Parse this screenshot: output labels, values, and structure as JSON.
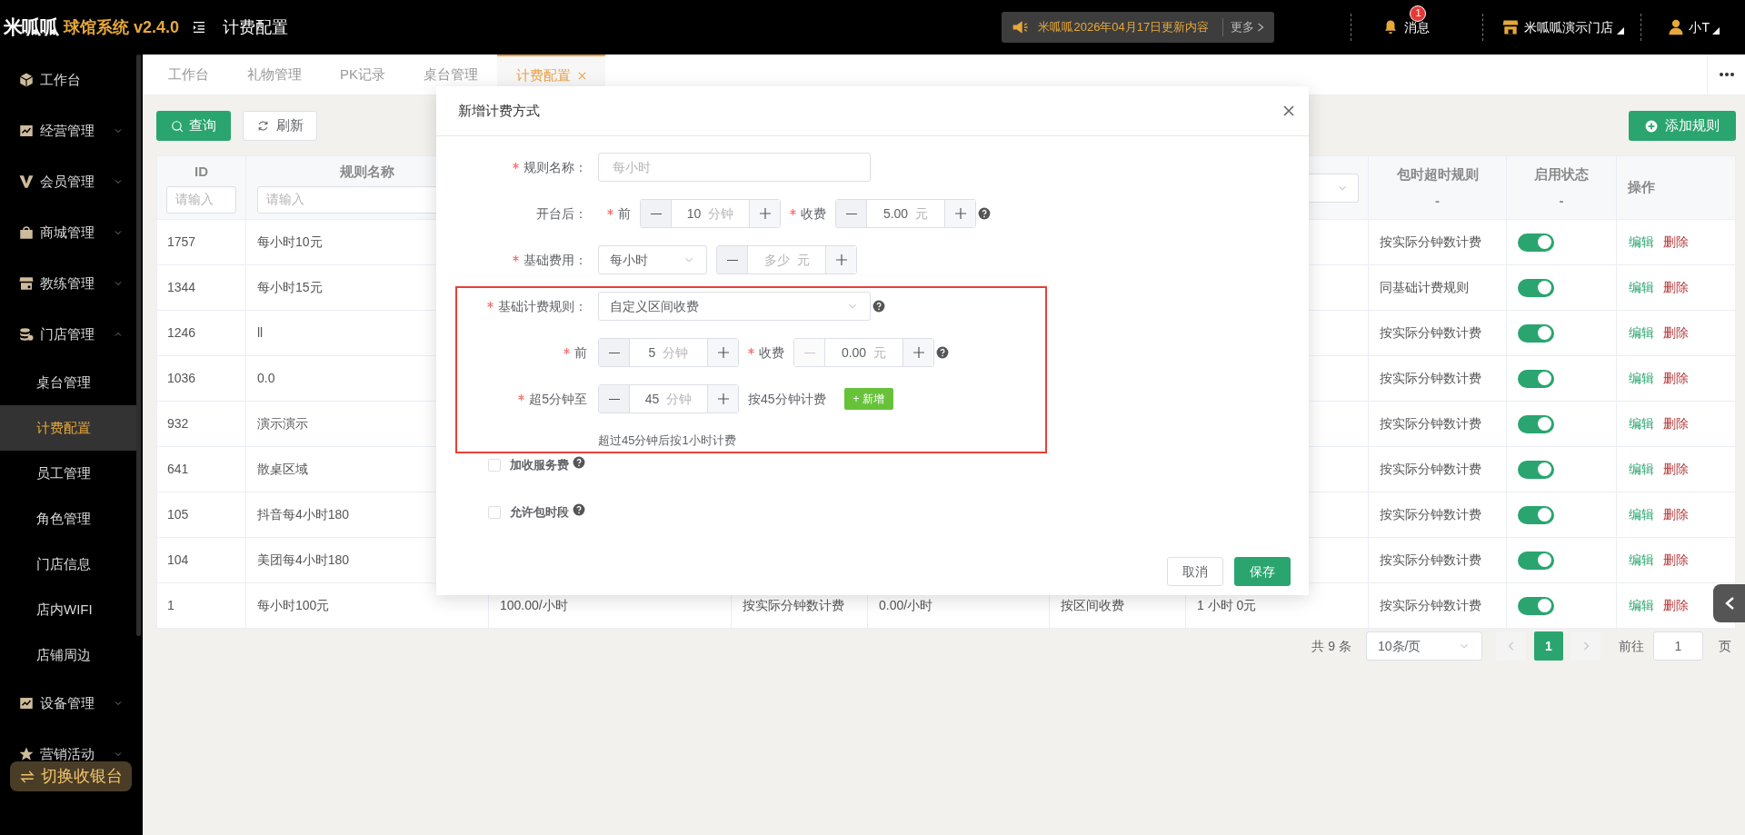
{
  "header": {
    "logo": "米呱呱",
    "app_title": "球馆系统 v2.4.0",
    "page_title": "计费配置",
    "notice": {
      "text": "米呱呱2026年04月17日更新内容",
      "more": "更多"
    },
    "messages": {
      "label": "消息",
      "badge": "1"
    },
    "store": "米呱呱演示门店",
    "user": "小T"
  },
  "sidebar": {
    "items": [
      {
        "label": "工作台"
      },
      {
        "label": "经营管理",
        "expanded": false
      },
      {
        "label": "会员管理",
        "expanded": false
      },
      {
        "label": "商城管理",
        "expanded": false
      },
      {
        "label": "教练管理",
        "expanded": false
      },
      {
        "label": "门店管理",
        "expanded": true,
        "children": [
          {
            "label": "桌台管理",
            "selected": false
          },
          {
            "label": "计费配置",
            "selected": true
          },
          {
            "label": "员工管理",
            "selected": false
          },
          {
            "label": "角色管理",
            "selected": false
          },
          {
            "label": "门店信息",
            "selected": false
          },
          {
            "label": "店内WIFI",
            "selected": false
          },
          {
            "label": "店铺周边",
            "selected": false
          }
        ]
      },
      {
        "label": "设备管理",
        "expanded": false
      },
      {
        "label": "营销活动",
        "expanded": false
      }
    ],
    "switch_button": "切换收银台"
  },
  "tabs": [
    {
      "label": "工作台",
      "selected": false
    },
    {
      "label": "礼物管理",
      "selected": false
    },
    {
      "label": "PK记录",
      "selected": false
    },
    {
      "label": "桌台管理",
      "selected": false
    },
    {
      "label": "计费配置",
      "selected": true
    }
  ],
  "toolbar": {
    "query": "查询",
    "refresh": "刷新",
    "add": "添加规则"
  },
  "table": {
    "id_column": {
      "title": "ID",
      "placeholder": "请输入"
    },
    "name_column": {
      "title": "规则名称",
      "placeholder": "请输入"
    },
    "column_7": {
      "filter": {
        "kind": "select"
      }
    },
    "overtime_column": {
      "title": "包时超时规则",
      "subtitle": "-"
    },
    "status_column": {
      "title": "启用状态",
      "subtitle": "-"
    },
    "actions_column": {
      "title": "操作"
    },
    "rows": [
      {
        "id": "1757",
        "name": "每小时10元",
        "overtime_rule": "按实际分钟数计费",
        "enabled": true,
        "actions": [
          {
            "label": "编辑",
            "kind": "edit"
          },
          {
            "label": "删除",
            "kind": "delete"
          }
        ]
      },
      {
        "id": "1344",
        "name": "每小时15元",
        "overtime_rule": "同基础计费规则",
        "enabled": true,
        "actions": [
          {
            "label": "编辑",
            "kind": "edit"
          },
          {
            "label": "删除",
            "kind": "delete"
          }
        ]
      },
      {
        "id": "1246",
        "name": "ll",
        "overtime_rule": "按实际分钟数计费",
        "enabled": true,
        "actions": [
          {
            "label": "编辑",
            "kind": "edit"
          },
          {
            "label": "删除",
            "kind": "delete"
          }
        ]
      },
      {
        "id": "1036",
        "name": "0.0",
        "overtime_rule": "按实际分钟数计费",
        "enabled": true,
        "actions": [
          {
            "label": "编辑",
            "kind": "edit"
          },
          {
            "label": "删除",
            "kind": "delete"
          }
        ]
      },
      {
        "id": "932",
        "name": "演示演示",
        "overtime_rule": "按实际分钟数计费",
        "enabled": true,
        "actions": [
          {
            "label": "编辑",
            "kind": "edit"
          },
          {
            "label": "删除",
            "kind": "delete"
          }
        ]
      },
      {
        "id": "641",
        "name": "散桌区域",
        "overtime_rule": "按实际分钟数计费",
        "enabled": true,
        "actions": [
          {
            "label": "编辑",
            "kind": "edit"
          },
          {
            "label": "删除",
            "kind": "delete"
          }
        ]
      },
      {
        "id": "105",
        "name": "抖音每4小时180",
        "overtime_rule": "按实际分钟数计费",
        "enabled": true,
        "actions": [
          {
            "label": "编辑",
            "kind": "edit"
          },
          {
            "label": "删除",
            "kind": "delete"
          }
        ]
      },
      {
        "id": "104",
        "name": "美团每4小时180",
        "overtime_rule": "按实际分钟数计费",
        "enabled": true,
        "actions": [
          {
            "label": "编辑",
            "kind": "edit"
          },
          {
            "label": "删除",
            "kind": "delete"
          }
        ]
      },
      {
        "id": "1",
        "name": "每小时100元",
        "column_3": "100.00/小时",
        "column_4": "按实际分钟数计费",
        "column_5": "0.00/小时",
        "column_6": "按区间收费",
        "column_7": "1 小时 0元",
        "overtime_rule": "按实际分钟数计费",
        "enabled": true,
        "actions": [
          {
            "label": "编辑",
            "kind": "edit"
          },
          {
            "label": "删除",
            "kind": "delete"
          }
        ]
      }
    ]
  },
  "pagination": {
    "total": "共 9 条",
    "page_size": "10条/页",
    "pages": [
      {
        "label": "1",
        "selected": true
      }
    ],
    "goto_label": "前往",
    "goto_value": "1",
    "goto_suffix": "页"
  },
  "dialog": {
    "title": "新增计费方式",
    "sections": [
      {
        "highlighted": false,
        "rows": [
          {
            "label": "规则名称：",
            "required": true,
            "items": [
              {
                "kind": "input",
                "placeholder": "每小时"
              }
            ]
          },
          {
            "label": "开台后：",
            "required": false,
            "items": [
              {
                "kind": "tag",
                "text": "前",
                "required": true
              },
              {
                "kind": "stepper",
                "value": "10",
                "unit": "分钟",
                "minus_disabled": false
              },
              {
                "kind": "tag",
                "text": "收费",
                "required": true
              },
              {
                "kind": "stepper",
                "value": "5.00",
                "unit": "元",
                "minus_disabled": false
              },
              {
                "kind": "help"
              }
            ]
          },
          {
            "label": "基础费用：",
            "required": true,
            "items": [
              {
                "kind": "select",
                "value": "每小时"
              },
              {
                "kind": "stepper",
                "placeholder": "多少",
                "unit": "元",
                "minus_disabled": false
              }
            ]
          }
        ]
      },
      {
        "highlighted": true,
        "rows": [
          {
            "label": "基础计费规则：",
            "required": true,
            "items": [
              {
                "kind": "select",
                "value": "自定义区间收费"
              },
              {
                "kind": "help"
              }
            ]
          },
          {
            "label": "前",
            "required": true,
            "items": [
              {
                "kind": "stepper",
                "value": "5",
                "unit": "分钟",
                "minus_disabled": false
              },
              {
                "kind": "tag",
                "text": "收费",
                "required": true
              },
              {
                "kind": "stepper",
                "value": "0.00",
                "unit": "元",
                "minus_disabled": true
              },
              {
                "kind": "help"
              }
            ]
          },
          {
            "label": "超5分钟至",
            "required": true,
            "items": [
              {
                "kind": "stepper",
                "value": "45",
                "unit": "分钟",
                "minus_disabled": false
              },
              {
                "kind": "text",
                "text": "按45分钟计费"
              },
              {
                "kind": "add_button",
                "text": "+ 新增"
              }
            ]
          }
        ],
        "note": "超过45分钟后按1小时计费"
      }
    ],
    "checkboxes": [
      {
        "label": "加收服务费",
        "checked": false,
        "help": true
      },
      {
        "label": "允许包时段",
        "checked": false,
        "help": true
      }
    ],
    "buttons": [
      {
        "label": "取消",
        "kind": "secondary"
      },
      {
        "label": "保存",
        "kind": "primary"
      }
    ]
  }
}
